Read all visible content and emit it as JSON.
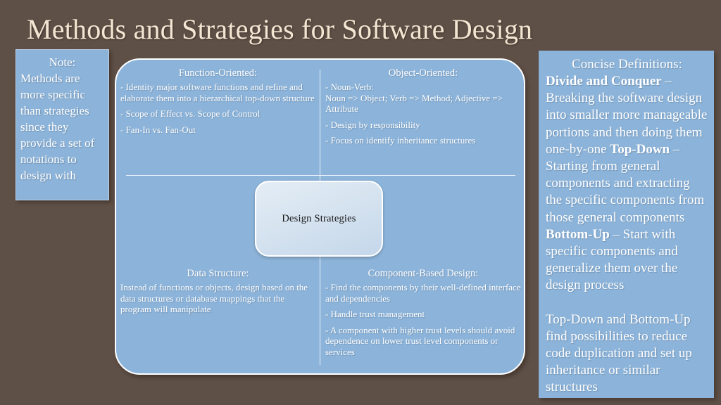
{
  "slide": {
    "title": "Methods and Strategies for Software Design",
    "background_color": "#5f5047",
    "panel_color": "#8cb4da",
    "title_color": "#f3e7d3"
  },
  "note": {
    "heading": "Note:",
    "text": "Methods are more specific than strategies since they provide a set of notations to design with"
  },
  "center": {
    "label": "Design Strategies"
  },
  "quadrants": {
    "function_oriented": {
      "heading": "Function-Oriented:",
      "bullets": [
        "- Identity major software functions and refine and elaborate them into a hierarchical top-down structure",
        "- Scope of Effect vs. Scope of Control",
        "- Fan-In vs. Fan-Out"
      ]
    },
    "object_oriented": {
      "heading": "Object-Oriented:",
      "bullets": [
        "- Noun-Verb:\nNoun => Object; Verb => Method; Adjective => Attribute",
        "- Design by responsibility",
        "- Focus on identify inheritance structures"
      ]
    },
    "data_structure": {
      "heading": "Data Structure:",
      "bullets": [
        "Instead of functions or objects, design based on the data structures or database mappings that the program will manipulate"
      ]
    },
    "component_based": {
      "heading": "Component-Based Design:",
      "bullets": [
        "- Find the components by their well-defined interface and dependencies",
        "- Handle trust management",
        "- A component with higher trust levels should avoid dependence on lower trust level components or services"
      ]
    }
  },
  "definitions": {
    "heading": "Concise Definitions:",
    "entries": [
      {
        "term": "Divide and Conquer",
        "dash": " – ",
        "text": "Breaking the software design into smaller more manageable portions and then doing them one-by-one"
      },
      {
        "term": "Top-Down",
        "dash": " – ",
        "text": "Starting from general components and extracting the specific components from those general components"
      },
      {
        "term": "Bottom-Up",
        "dash": " – ",
        "text": "Start with specific components and generalize them over the design process"
      }
    ],
    "closing": "Top-Down and Bottom-Up find possibilities to reduce code duplication and set up inheritance or similar structures"
  }
}
